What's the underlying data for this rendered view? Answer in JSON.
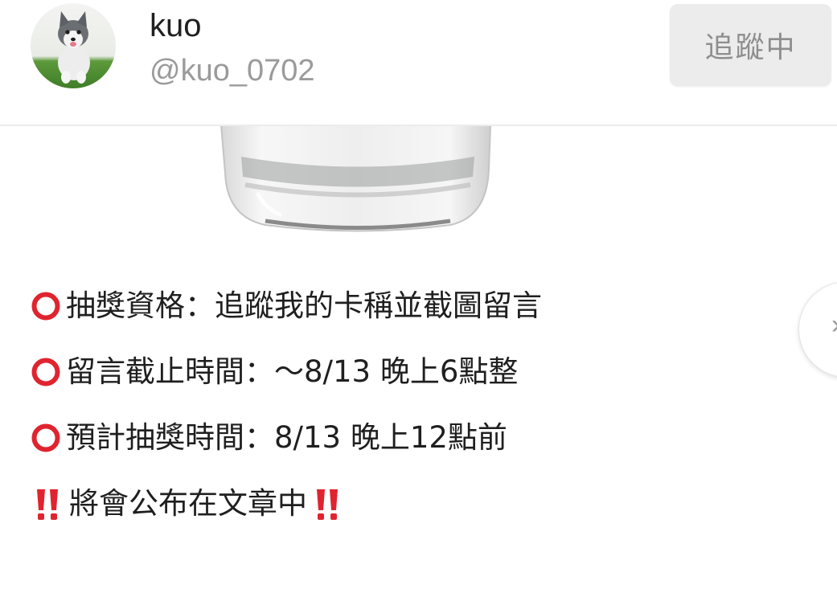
{
  "header": {
    "display_name": "kuo",
    "handle": "@kuo_0702",
    "follow_label": "追蹤中"
  },
  "post": {
    "lines": [
      {
        "icon": "red-ring-icon",
        "text": "抽獎資格：追蹤我的卡稱並截圖留言"
      },
      {
        "icon": "red-ring-icon",
        "text": "留言截止時間：～8/13 晚上6點整"
      },
      {
        "icon": "red-ring-icon",
        "text": "預計抽獎時間：8/13 晚上12點前"
      }
    ],
    "announce": {
      "icon": "double-exclamation-icon",
      "text": "將會公布在文章中"
    }
  },
  "colors": {
    "accent_red": "#e0242f",
    "button_bg": "#ececec",
    "handle_gray": "#9a9a9a"
  }
}
